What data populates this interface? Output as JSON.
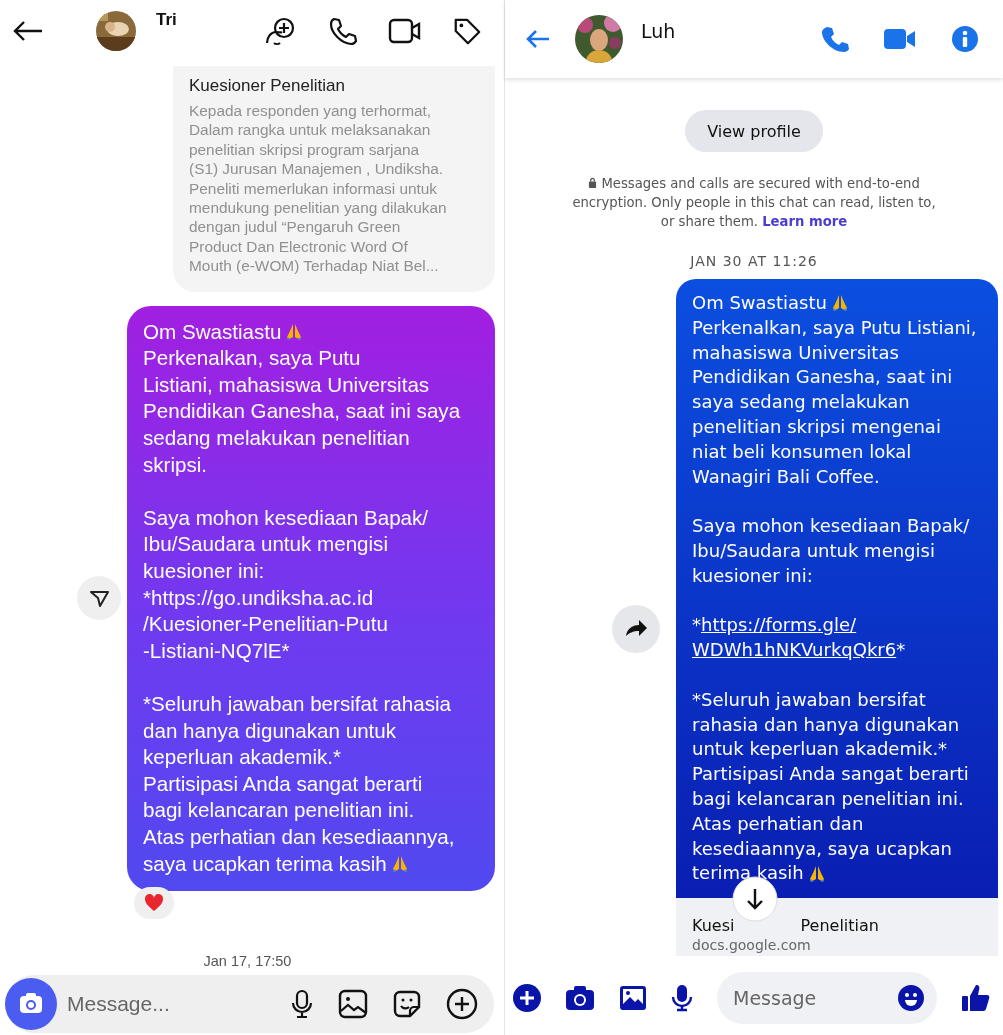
{
  "left_chat": {
    "header": {
      "name": "Tri"
    },
    "link_card": {
      "title": "Kuesioner Penelitian",
      "description": "Kepada responden yang terhormat,\nDalam rangka untuk melaksanakan\npenelitian skripsi program sarjana\n(S1) Jurusan Manajemen , Undiksha.\nPeneliti memerlukan informasi untuk\nmendukung penelitian yang dilakukan\ndengan judul “Pengaruh Green\nProduct Dan Electronic Word Of\nMouth (e-WOM) Terhadap Niat Bel..."
    },
    "message": {
      "blocks": [
        {
          "paragraphs": [
            {
              "kind": "text",
              "tail": "Om Swastiastu",
              "pray_icon": true
            },
            {
              "kind": "text",
              "text": "Perkenalkan, saya Putu\nListiani, mahasiswa Universitas\nPendidikan Ganesha, saat ini saya\nsedang melakukan penelitian\nskripsi."
            }
          ]
        },
        {
          "paragraphs": [
            {
              "kind": "text",
              "text": "Saya mohon kesediaan Bapak/\nIbu/Saudara untuk mengisi\nkuesioner ini:\n*https://go.undiksha.ac.id\n/Kuesioner-Penelitian-Putu\n-Listiani-NQ7lE*"
            }
          ]
        },
        {
          "paragraphs": [
            {
              "kind": "text",
              "text": "*Seluruh jawaban bersifat rahasia\ndan hanya digunakan untuk\nkeperluan akademik.*\nPartisipasi Anda sangat berarti\nbagi kelancaran penelitian ini.\nAtas perhatian dan kesediaannya,",
              "tail": "saya ucapkan terima kasih",
              "pray_icon": true
            }
          ]
        }
      ]
    },
    "reaction": {
      "kind": "heart"
    },
    "timestamp": "Jan 17, 17:50",
    "composer": {
      "placeholder": "Message..."
    }
  },
  "right_chat": {
    "header": {
      "name": "Luh"
    },
    "view_profile_button": "View profile",
    "encryption_notice": {
      "text": "Messages and calls are secured with end-to-end encryption. Only people in this chat can read, listen to, or share them.",
      "link": "Learn more"
    },
    "timestamp": "JAN 30 AT 11:26",
    "message": {
      "blocks": [
        {
          "paragraphs": [
            {
              "kind": "text",
              "tail": "Om Swastiastu",
              "pray_icon": true
            },
            {
              "kind": "text",
              "text": "Perkenalkan, saya Putu Listiani,\nmahasiswa Universitas\nPendidikan Ganesha, saat ini\nsaya sedang melakukan\npenelitian  skripsi mengenai\nniat beli konsumen lokal\nWanagiri Bali Coffee."
            }
          ]
        },
        {
          "paragraphs": [
            {
              "kind": "text",
              "text": "Saya mohon kesediaan Bapak/\nIbu/Saudara untuk mengisi\nkuesioner ini:"
            }
          ]
        },
        {
          "paragraphs": [
            {
              "kind": "link",
              "prefix": "*",
              "url": "https://forms.gle/\nWDWh1hNKVurkqQkr6",
              "suffix": "*"
            }
          ]
        },
        {
          "paragraphs": [
            {
              "kind": "text",
              "text": "*Seluruh jawaban bersifat\nrahasia dan hanya digunakan\nuntuk keperluan akademik.*\nPartisipasi Anda sangat berarti\nbagi kelancaran penelitian ini.\nAtas perhatian dan\nkesediaannya, saya ucapkan",
              "tail": "terima kasih",
              "pray_icon": true
            }
          ]
        }
      ]
    },
    "link_preview": {
      "title_start": "Kuesi",
      "title_end": "Penelitian",
      "domain": "docs.google.com"
    },
    "composer": {
      "placeholder": "Message"
    }
  }
}
